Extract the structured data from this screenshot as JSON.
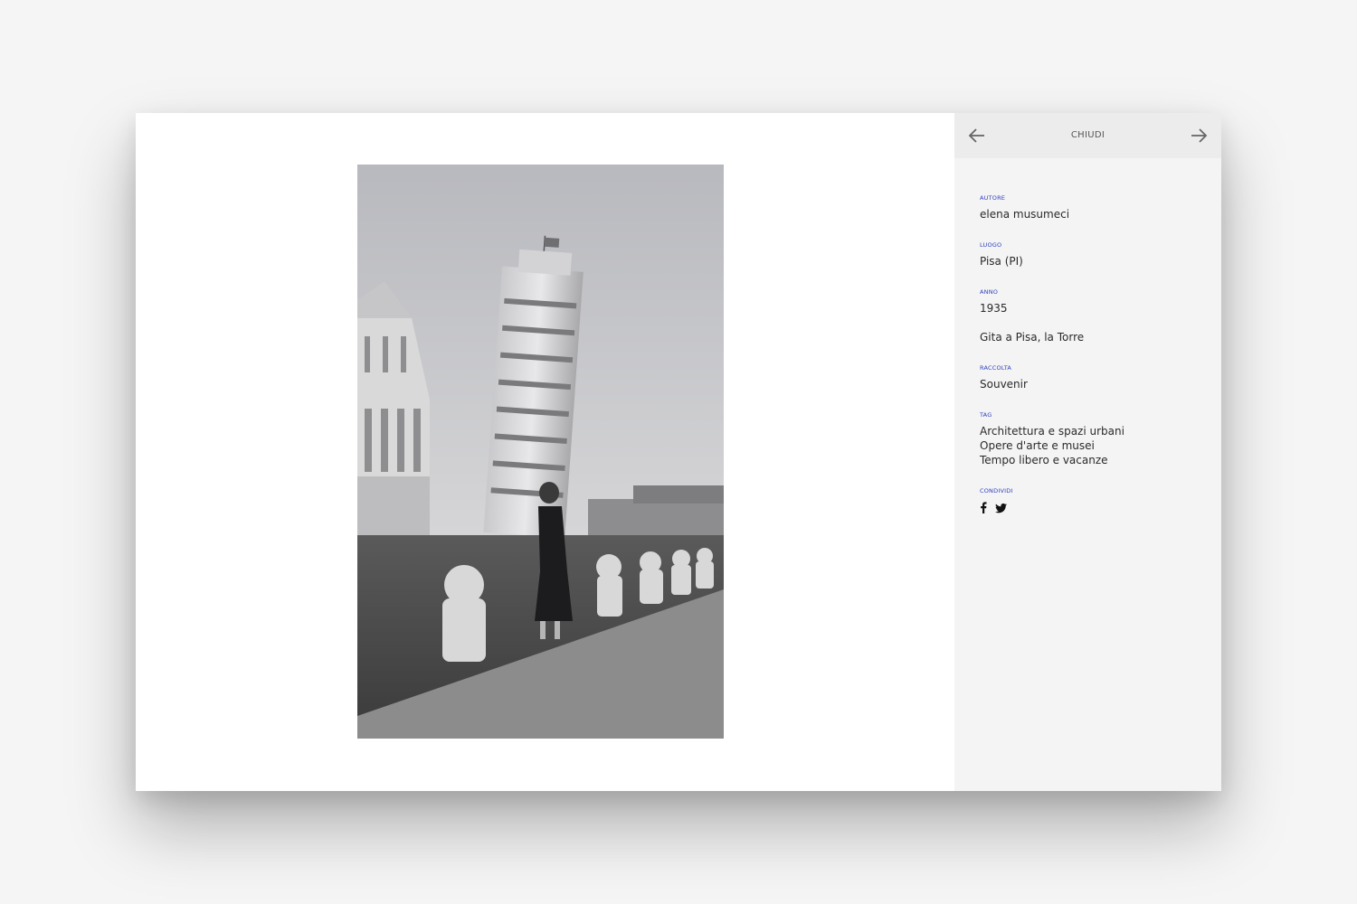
{
  "header": {
    "close_label": "CHIUDI",
    "prev_icon": "arrow-left-icon",
    "next_icon": "arrow-right-icon"
  },
  "details": {
    "author": {
      "label": "AUTORE",
      "value": "elena musumeci"
    },
    "place": {
      "label": "LUOGO",
      "value": "Pisa (PI)"
    },
    "year": {
      "label": "ANNO",
      "value": "1935"
    },
    "title": "Gita a Pisa, la Torre",
    "collection": {
      "label": "RACCOLTA",
      "value": "Souvenir"
    },
    "tags": {
      "label": "TAG",
      "items": [
        "Architettura e spazi urbani",
        "Opere d'arte e musei",
        "Tempo libero e vacanze"
      ]
    },
    "share": {
      "label": "CONDIVIDI",
      "icons": [
        "facebook-icon",
        "twitter-icon"
      ]
    }
  },
  "colors": {
    "label_accent": "#2c3fbf",
    "panel_bg": "#f4f4f4",
    "header_bg": "#ececec"
  }
}
